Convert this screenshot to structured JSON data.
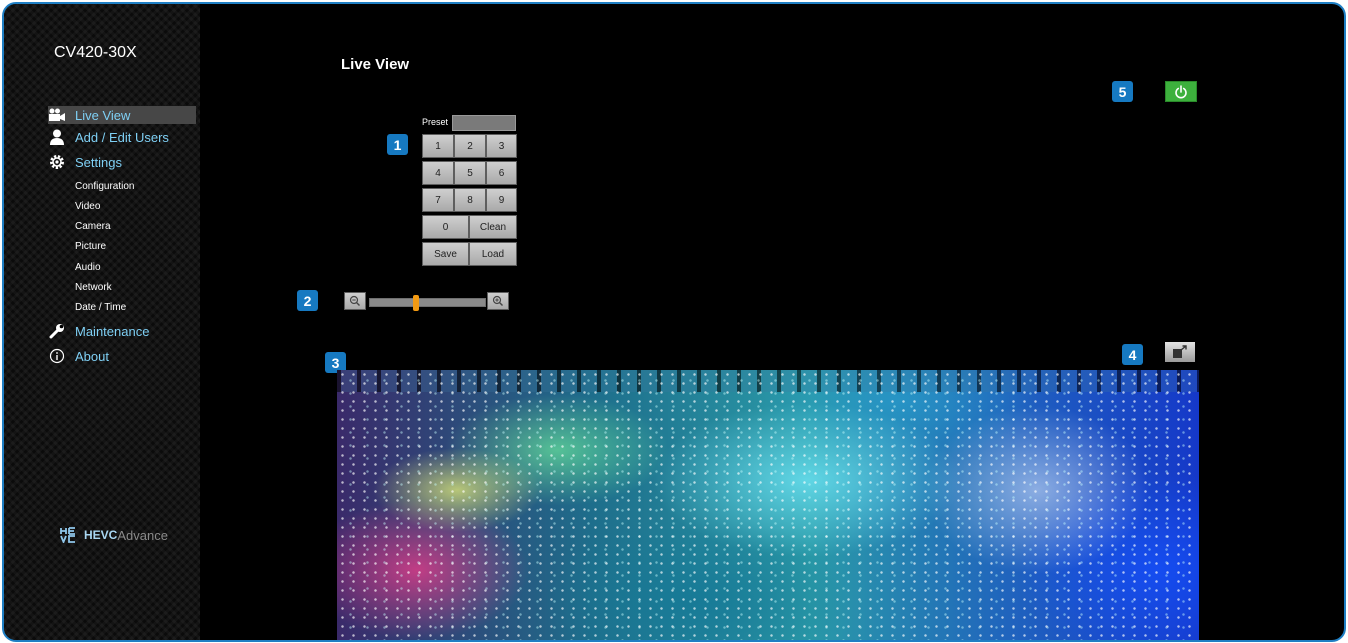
{
  "product_name": "CV420-30X",
  "page_title": "Live View",
  "nav": {
    "live_view": "Live View",
    "add_edit_users": "Add / Edit Users",
    "settings": "Settings",
    "configuration": "Configuration",
    "video": "Video",
    "camera": "Camera",
    "picture": "Picture",
    "audio": "Audio",
    "network": "Network",
    "date_time": "Date / Time",
    "maintenance": "Maintenance",
    "about": "About"
  },
  "logo": {
    "mark": "HE VC",
    "hevc": "HEVC",
    "advance": "Advance"
  },
  "preset": {
    "label": "Preset",
    "value": "",
    "keys": [
      "1",
      "2",
      "3",
      "4",
      "5",
      "6",
      "7",
      "8",
      "9",
      "0"
    ],
    "clean": "Clean",
    "save": "Save",
    "load": "Load"
  },
  "zoom": {
    "level": 0.4
  },
  "badges": [
    "1",
    "2",
    "3",
    "4",
    "5"
  ],
  "icons": {
    "live_view": "video-camera-icon",
    "users": "user-icon",
    "settings": "gear-icon",
    "maintenance": "wrench-icon",
    "about": "info-icon",
    "zoom_out": "zoom-out-icon",
    "zoom_in": "zoom-in-icon",
    "power": "power-icon",
    "fullscreen": "fullscreen-icon"
  },
  "colors": {
    "accent": "#1679c1",
    "nav_text": "#7fd0f5",
    "power": "#3db03d",
    "zoom_handle": "#f39a12"
  }
}
